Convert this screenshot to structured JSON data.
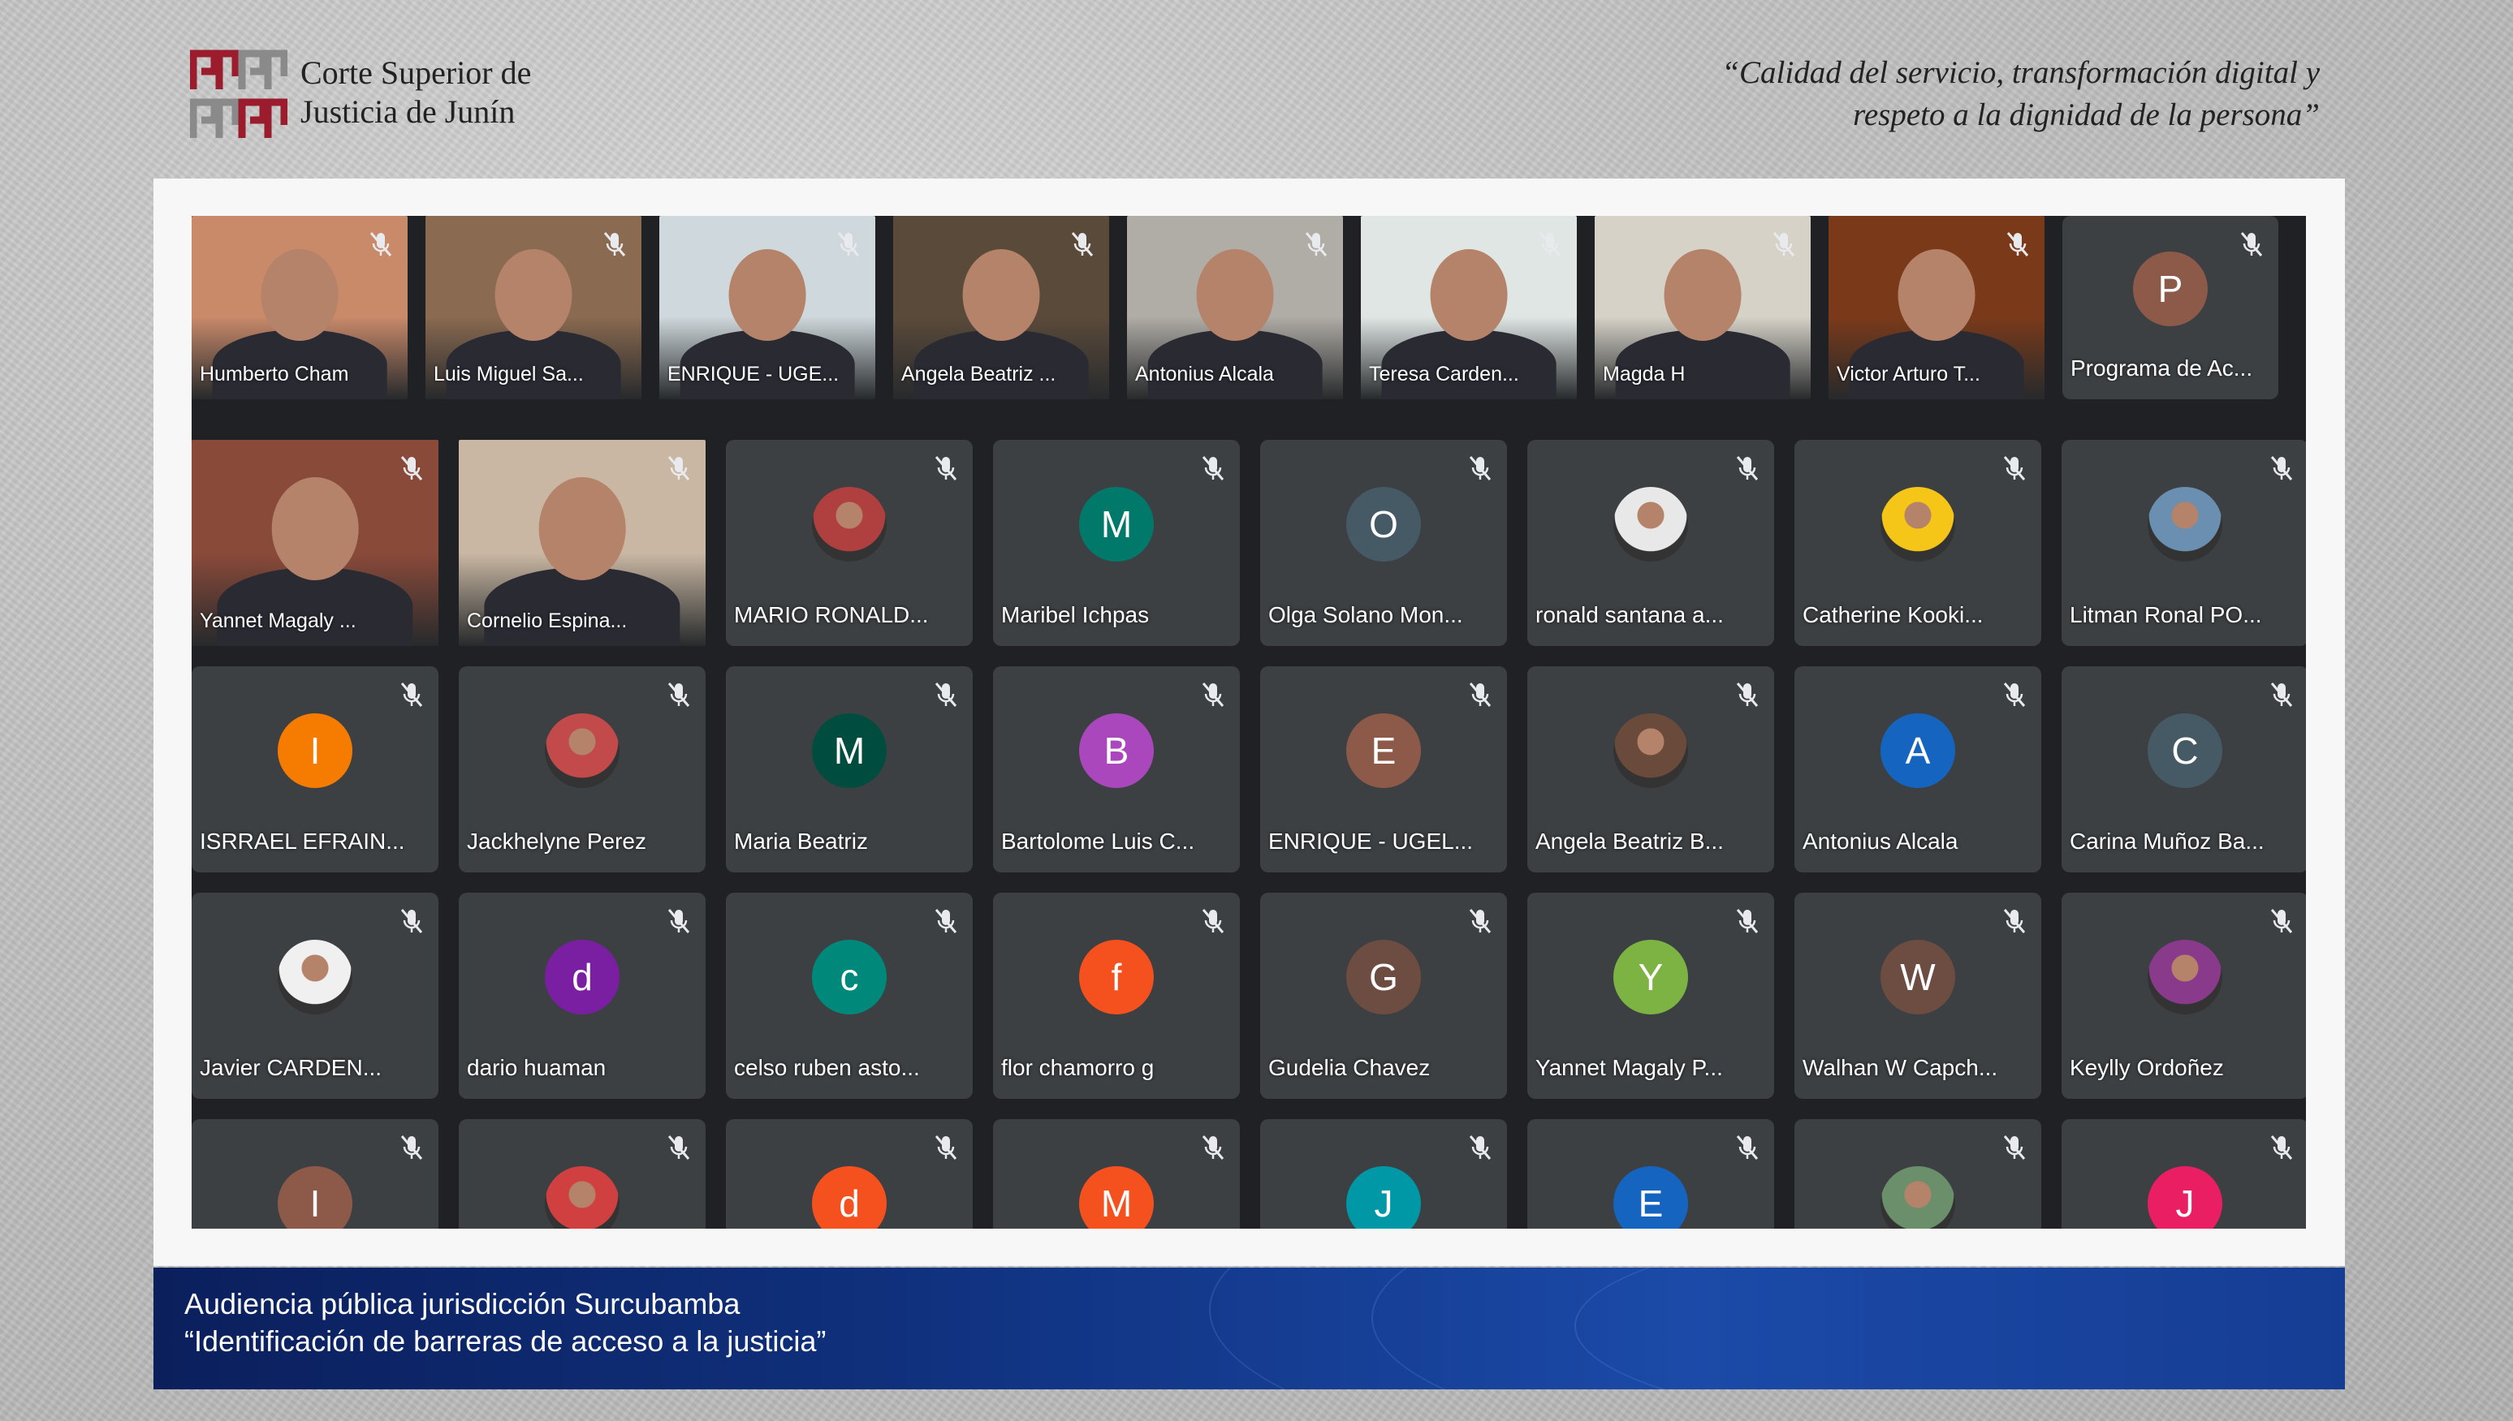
{
  "header": {
    "org_line1": "Corte Superior de",
    "org_line2": "Justicia de Junín",
    "motto_line1": "“Calidad del servicio, transformación digital y",
    "motto_line2": "respeto a la dignidad de la persona”",
    "logo_colors": [
      "#9b1c2c",
      "#8a8a8a"
    ]
  },
  "participants_top": [
    {
      "name": "Humberto Cham",
      "bg": "#c98a6a",
      "muted": true
    },
    {
      "name": "Luis Miguel Sa...",
      "bg": "#8a6a50",
      "muted": true
    },
    {
      "name": "ENRIQUE - UGE...",
      "bg": "#cfd8dc",
      "muted": true
    },
    {
      "name": "Angela Beatriz ...",
      "bg": "#5a4a3a",
      "muted": true
    },
    {
      "name": "Antonius Alcala",
      "bg": "#b0aca6",
      "muted": true
    },
    {
      "name": "Teresa Carden...",
      "bg": "#dfe6e4",
      "muted": true
    },
    {
      "name": "Magda H",
      "bg": "#d6d2c8",
      "muted": true
    },
    {
      "name": "Victor Arturo T...",
      "bg": "#7a3a1a",
      "muted": true
    },
    {
      "name": "Programa de Ac...",
      "initial": "P",
      "color": "#8d5a4a",
      "muted": true
    }
  ],
  "participants": [
    {
      "name": "Yannet Magaly ...",
      "video": true,
      "bg": "#8a4a3a",
      "muted": true
    },
    {
      "name": "Cornelio Espina...",
      "video": true,
      "bg": "#c9b7a3",
      "muted": true
    },
    {
      "name": "MARIO RONALD...",
      "photo": true,
      "color": "#b04040",
      "muted": true
    },
    {
      "name": "Maribel Ichpas",
      "initial": "M",
      "color": "#00796b",
      "muted": true
    },
    {
      "name": "Olga Solano Mon...",
      "initial": "O",
      "color": "#455a64",
      "muted": true
    },
    {
      "name": "ronald santana a...",
      "photo": true,
      "color": "#e8e8e8",
      "muted": true
    },
    {
      "name": "Catherine Kooki...",
      "photo": true,
      "color": "#f5c518",
      "muted": true
    },
    {
      "name": "Litman Ronal PO...",
      "photo": true,
      "color": "#6a8fb0",
      "muted": true
    },
    {
      "name": "ISRRAEL EFRAIN...",
      "initial": "I",
      "color": "#f57c00",
      "muted": true
    },
    {
      "name": "Jackhelyne Perez",
      "photo": true,
      "color": "#c24a4a",
      "muted": true
    },
    {
      "name": "Maria Beatriz",
      "initial": "M",
      "color": "#004d40",
      "muted": true
    },
    {
      "name": "Bartolome Luis C...",
      "initial": "B",
      "color": "#ab47bc",
      "muted": true
    },
    {
      "name": "ENRIQUE - UGEL...",
      "initial": "E",
      "color": "#8d5a4a",
      "muted": true
    },
    {
      "name": "Angela Beatriz B...",
      "photo": true,
      "color": "#6a4a3a",
      "muted": true
    },
    {
      "name": "Antonius Alcala",
      "initial": "A",
      "color": "#1565c0",
      "muted": true
    },
    {
      "name": "Carina Muñoz Ba...",
      "initial": "C",
      "color": "#455a64",
      "muted": true
    },
    {
      "name": "Javier CARDEN...",
      "photo": true,
      "color": "#f0f0f0",
      "muted": true
    },
    {
      "name": "dario huaman",
      "initial": "d",
      "color": "#7b1fa2",
      "muted": true
    },
    {
      "name": "celso ruben asto...",
      "initial": "c",
      "color": "#00897b",
      "muted": true
    },
    {
      "name": "flor chamorro g",
      "initial": "f",
      "color": "#f4511e",
      "muted": true
    },
    {
      "name": "Gudelia Chavez",
      "initial": "G",
      "color": "#6d4c41",
      "muted": true
    },
    {
      "name": "Yannet Magaly P...",
      "initial": "Y",
      "color": "#7cb342",
      "muted": true
    },
    {
      "name": "Walhan W Capch...",
      "initial": "W",
      "color": "#6d4c41",
      "muted": true
    },
    {
      "name": "Keylly Ordoñez",
      "photo": true,
      "color": "#8a3a8a",
      "muted": true
    },
    {
      "name": "",
      "initial": "I",
      "color": "#8d5a4a",
      "muted": true
    },
    {
      "name": "",
      "photo": true,
      "color": "#d04040",
      "muted": true
    },
    {
      "name": "",
      "initial": "d",
      "color": "#f4511e",
      "muted": true
    },
    {
      "name": "",
      "initial": "M",
      "color": "#f4511e",
      "muted": true
    },
    {
      "name": "",
      "initial": "J",
      "color": "#0097a7",
      "muted": true
    },
    {
      "name": "",
      "initial": "E",
      "color": "#1565c0",
      "muted": true
    },
    {
      "name": "",
      "photo": true,
      "color": "#6a8f6a",
      "muted": true
    },
    {
      "name": "",
      "initial": "J",
      "color": "#e91e63",
      "muted": true
    }
  ],
  "banner": {
    "line1": "Audiencia pública jurisdicción Surcubamba",
    "line2": "“Identificación de barreras de acceso a la justicia”"
  }
}
